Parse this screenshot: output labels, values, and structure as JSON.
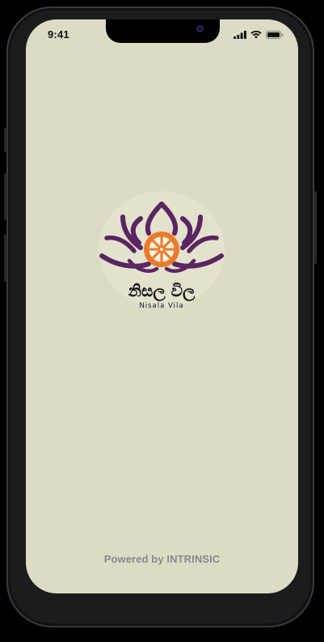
{
  "status_bar": {
    "time": "9:41",
    "icons": [
      "signal-icon",
      "wifi-icon",
      "battery-icon"
    ]
  },
  "splash": {
    "logo_name": "Nisala Vila",
    "logo_sinhala": "නිසල විල",
    "powered_by": "Powered by INTRINSIC"
  },
  "colors": {
    "screen_background": "#dcdcc6",
    "lotus_purple": "#5a2560",
    "dharma_wheel_orange": "#ec7a2a",
    "powered_text": "#8a8a84",
    "device_frame": "#1b1c1e"
  }
}
